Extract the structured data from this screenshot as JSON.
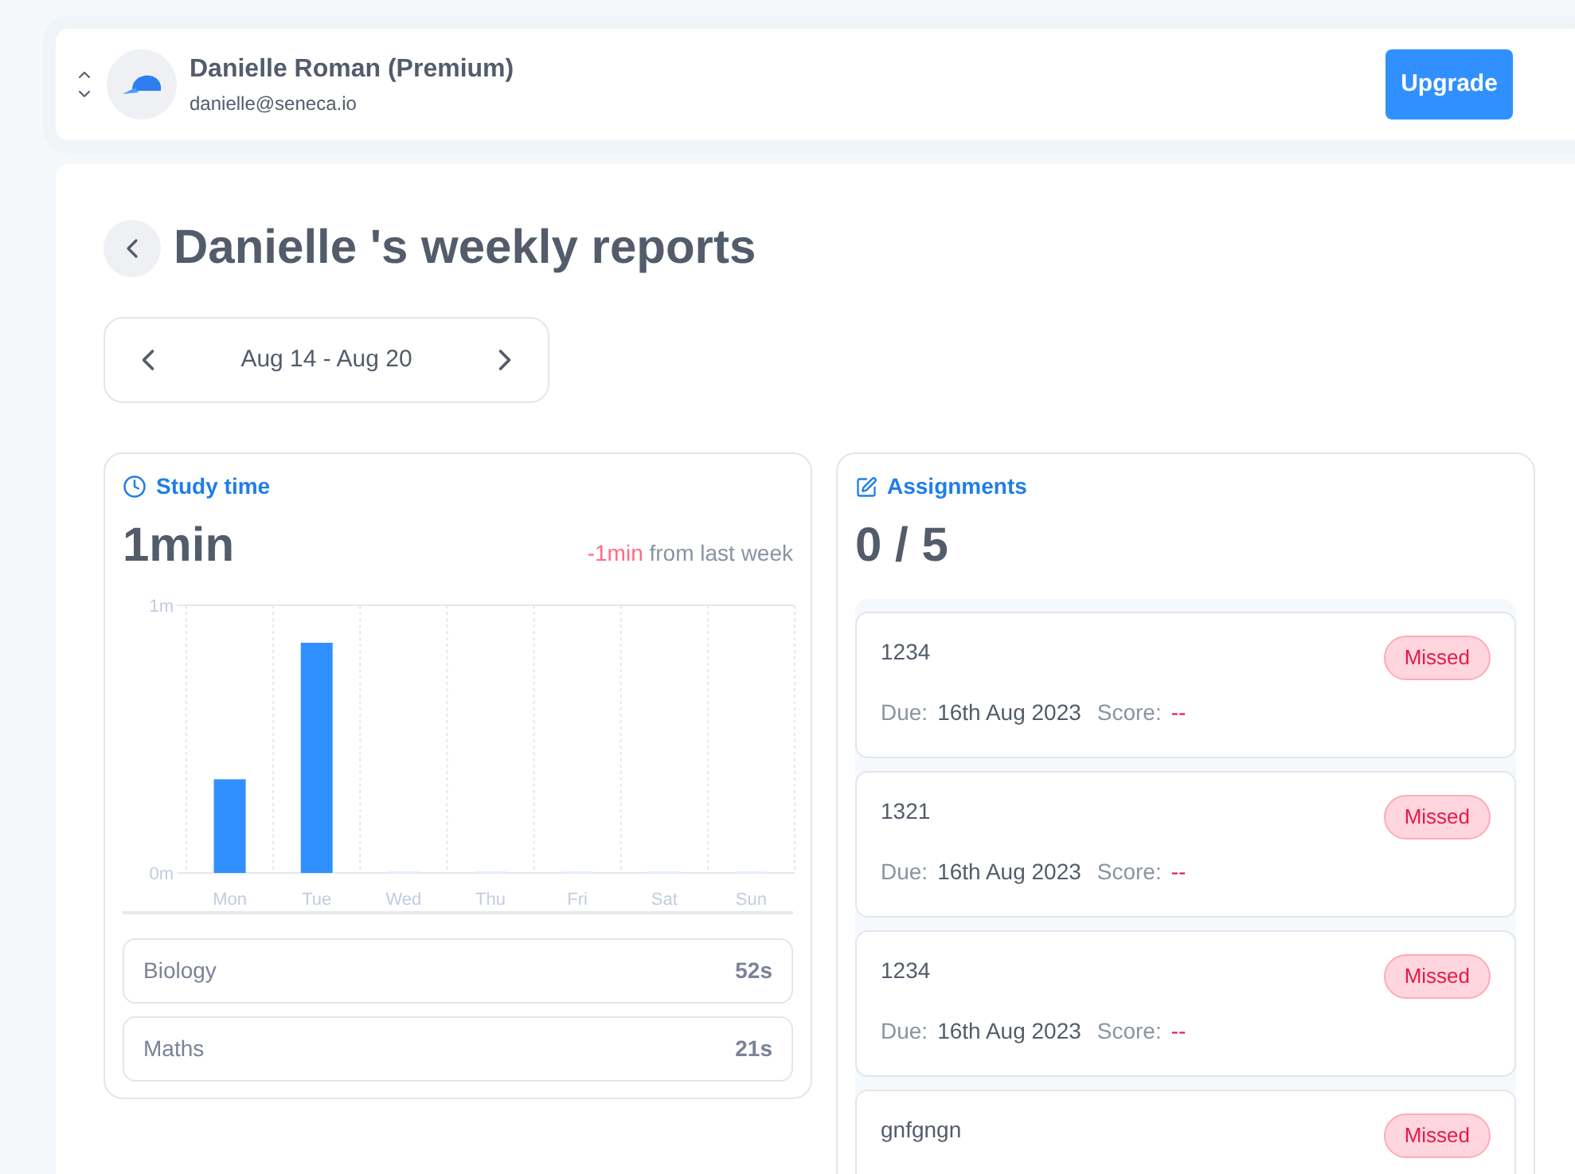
{
  "account": {
    "name": "Danielle Roman (Premium)",
    "email": "danielle@seneca.io",
    "upgrade_button": "Upgrade"
  },
  "report": {
    "title": "Danielle 's weekly reports",
    "date_range": "Aug 14 - Aug 20"
  },
  "study_time": {
    "heading": "Study time",
    "total": "1min",
    "change": "-1min",
    "change_suffix": "from last week",
    "chart_data": {
      "type": "bar",
      "categories": [
        "Mon",
        "Tue",
        "Wed",
        "Thu",
        "Fri",
        "Sat",
        "Sun"
      ],
      "values": [
        0.35,
        0.86,
        0,
        0,
        0,
        0,
        0
      ],
      "ylim": [
        0,
        1
      ],
      "yticks": [
        {
          "value": 0,
          "label": "0m"
        },
        {
          "value": 1,
          "label": "1m"
        }
      ]
    },
    "subjects": [
      {
        "name": "Biology",
        "time": "52s"
      },
      {
        "name": "Maths",
        "time": "21s"
      }
    ]
  },
  "assignments": {
    "heading": "Assignments",
    "total": "0 / 5",
    "items": [
      {
        "title": "1234",
        "status": "Missed",
        "due_label": "Due:",
        "due": "16th Aug 2023",
        "score_label": "Score:",
        "score": "--"
      },
      {
        "title": "1321",
        "status": "Missed",
        "due_label": "Due:",
        "due": "16th Aug 2023",
        "score_label": "Score:",
        "score": "--"
      },
      {
        "title": "1234",
        "status": "Missed",
        "due_label": "Due:",
        "due": "16th Aug 2023",
        "score_label": "Score:",
        "score": "--"
      },
      {
        "title": "gnfgngn",
        "status": "Missed"
      }
    ]
  }
}
